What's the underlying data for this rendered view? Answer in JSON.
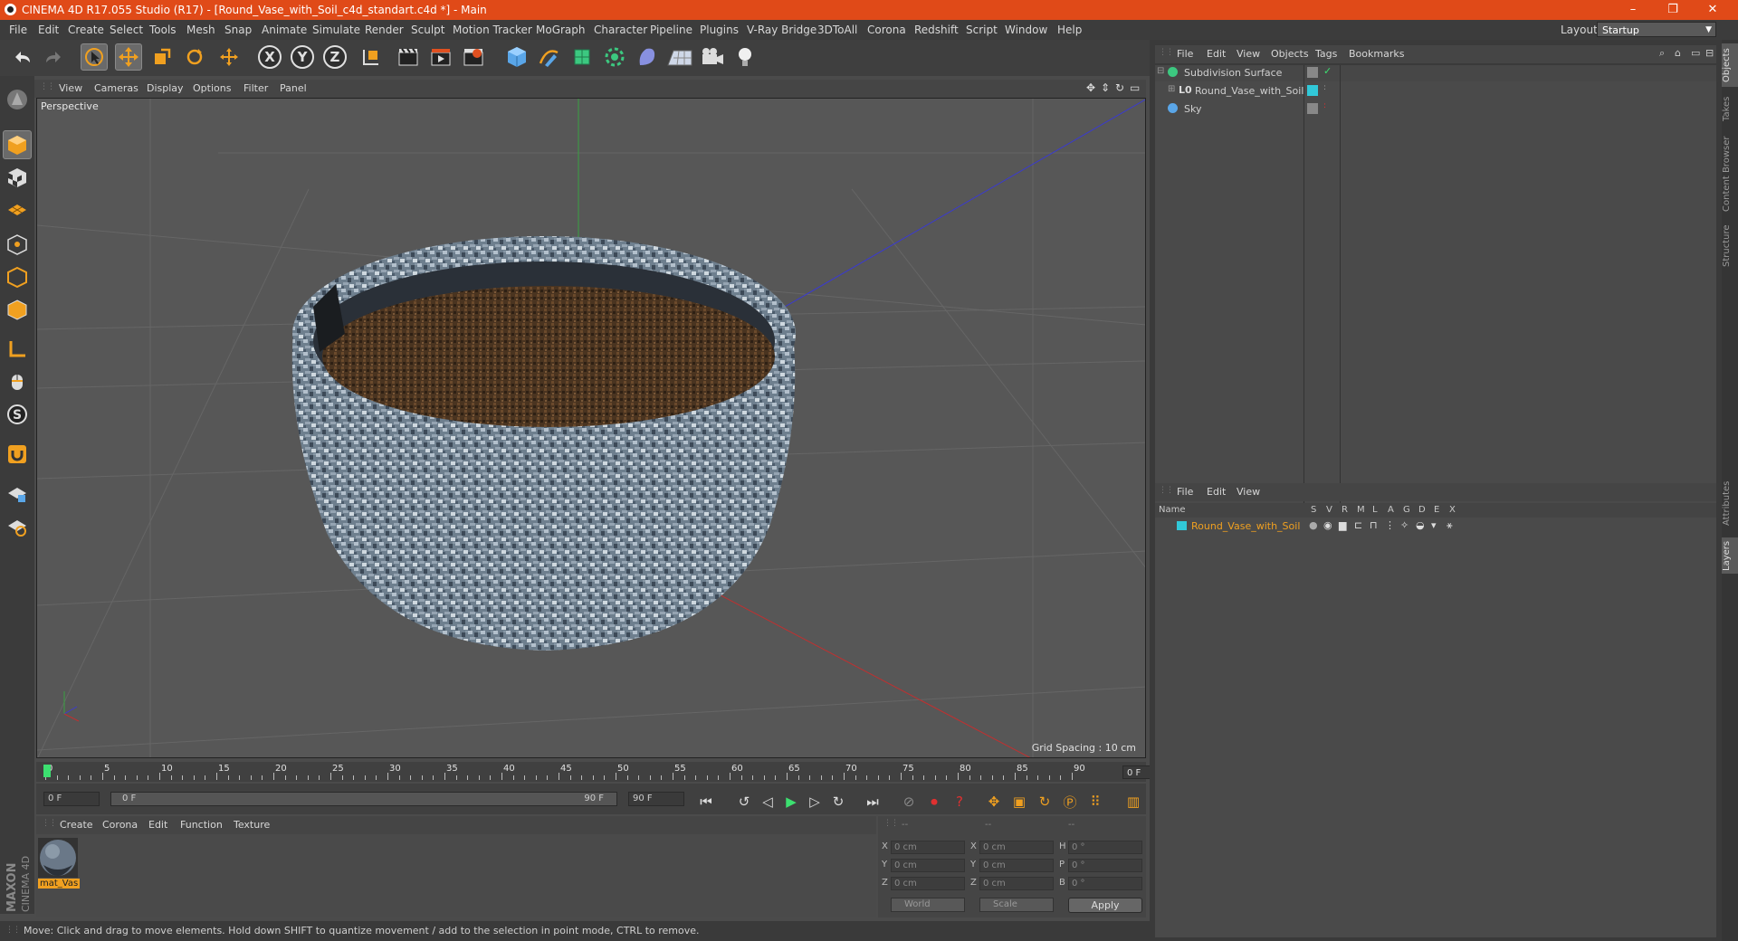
{
  "window": {
    "title": "CINEMA 4D R17.055 Studio (R17) - [Round_Vase_with_Soil_c4d_standart.c4d *] - Main",
    "controls": [
      "–",
      "❐",
      "✕"
    ]
  },
  "menubar": {
    "items": [
      "File",
      "Edit",
      "Create",
      "Select",
      "Tools",
      "Mesh",
      "Snap",
      "Animate",
      "Simulate",
      "Render",
      "Sculpt",
      "Motion Tracker",
      "MoGraph",
      "Character",
      "Pipeline",
      "Plugins",
      "V-Ray Bridge",
      "3DToAll",
      "Corona",
      "Redshift",
      "Script",
      "Window",
      "Help"
    ],
    "layout_label": "Layout:",
    "layout_value": "Startup"
  },
  "toolbar": {
    "axis_x": "X",
    "axis_y": "Y",
    "axis_z": "Z"
  },
  "viewport": {
    "menu": [
      "View",
      "Cameras",
      "Display",
      "Options",
      "Filter",
      "Panel"
    ],
    "label": "Perspective",
    "grid_spacing": "Grid Spacing : 10 cm"
  },
  "timeline": {
    "ticks": [
      "0",
      "5",
      "10",
      "15",
      "20",
      "25",
      "30",
      "35",
      "40",
      "45",
      "50",
      "55",
      "60",
      "65",
      "70",
      "75",
      "80",
      "85",
      "90"
    ],
    "current_frame": "0 F",
    "start_field": "0 F",
    "range_start": "0 F",
    "range_end": "90 F",
    "end_field": "90 F"
  },
  "material_manager": {
    "menu": [
      "Create",
      "Corona",
      "Edit",
      "Function",
      "Texture"
    ],
    "materials": [
      {
        "name": "mat_Vas"
      }
    ]
  },
  "coordinates": {
    "headers": [
      "--",
      "--",
      "--"
    ],
    "rows": [
      {
        "l1": "X",
        "v1": "0 cm",
        "l2": "X",
        "v2": "0 cm",
        "l3": "H",
        "v3": "0 °"
      },
      {
        "l1": "Y",
        "v1": "0 cm",
        "l2": "Y",
        "v2": "0 cm",
        "l3": "P",
        "v3": "0 °"
      },
      {
        "l1": "Z",
        "v1": "0 cm",
        "l2": "Z",
        "v2": "0 cm",
        "l3": "B",
        "v3": "0 °"
      }
    ],
    "mode_world": "World",
    "mode_scale": "Scale",
    "apply": "Apply"
  },
  "status": {
    "text": "Move: Click and drag to move elements. Hold down SHIFT to quantize movement / add to the selection in point mode, CTRL to remove."
  },
  "branding": {
    "maxon": "MAXON",
    "product": "CINEMA 4D"
  },
  "object_manager": {
    "menu": [
      "File",
      "Edit",
      "View",
      "Objects",
      "Tags",
      "Bookmarks"
    ],
    "objects": [
      {
        "name": "Subdivision Surface"
      },
      {
        "name": "Round_Vase_with_Soil"
      },
      {
        "name": "Sky"
      }
    ]
  },
  "layer_manager": {
    "menu": [
      "File",
      "Edit",
      "View"
    ],
    "columns": [
      "Name",
      "S",
      "V",
      "R",
      "M",
      "L",
      "A",
      "G",
      "D",
      "E",
      "X"
    ],
    "layers": [
      {
        "name": "Round_Vase_with_Soil",
        "color": "#31c8d8"
      }
    ]
  },
  "side_tabs": [
    "Objects",
    "Takes",
    "Content Browser",
    "Structure",
    "Attributes",
    "Layers"
  ],
  "colors": {
    "title_bar": "#e04a18",
    "accent_orange": "#f0a020",
    "layer_cyan": "#31c8d8"
  }
}
